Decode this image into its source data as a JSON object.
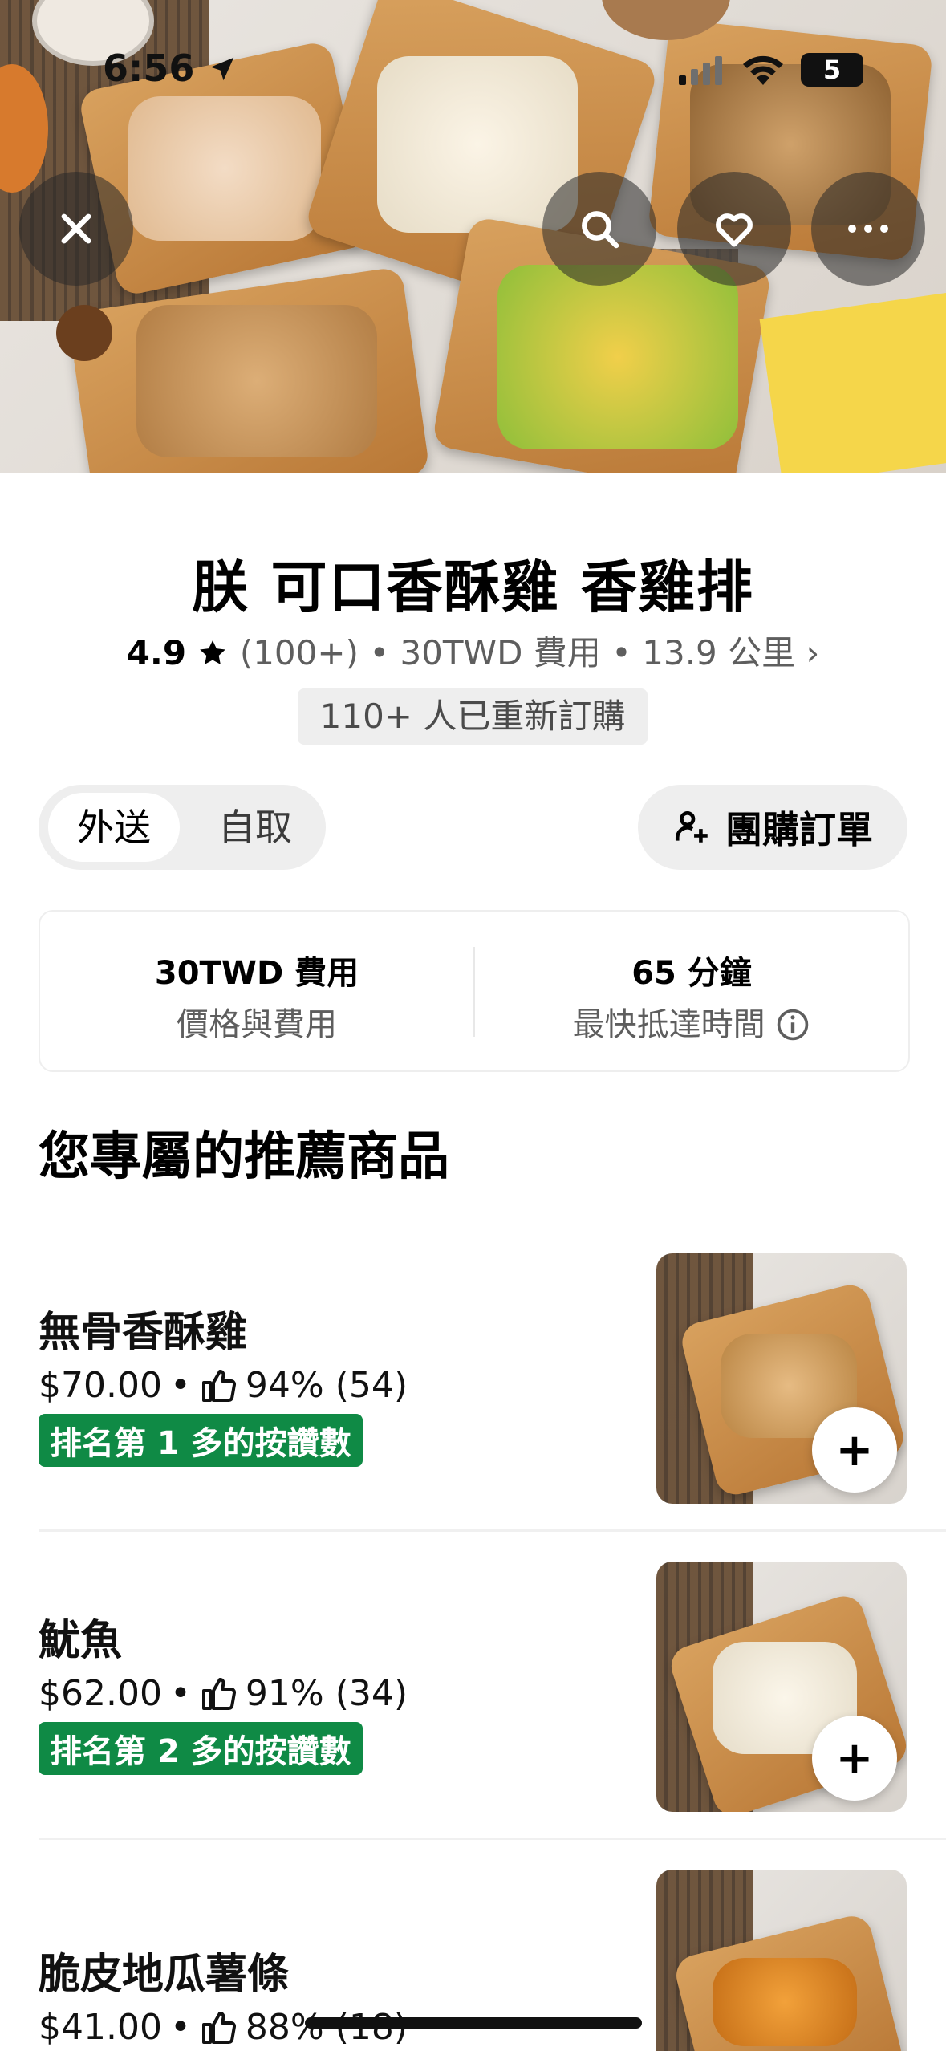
{
  "status_bar": {
    "time": "6:56",
    "battery": "5"
  },
  "restaurant": {
    "name": "朕 可口香酥雞 香雞排",
    "rating": "4.9",
    "rating_count": "(100+)",
    "fee": "30TWD 費用",
    "distance": "13.9 公里",
    "reorder": "110+ 人已重新訂購"
  },
  "mode_toggle": {
    "delivery": "外送",
    "pickup": "自取"
  },
  "group_order": {
    "label": "團購訂單"
  },
  "info": {
    "fee_main": "30TWD 費用",
    "fee_sub": "價格與費用",
    "time_main": "65 分鐘",
    "time_sub": "最快抵達時間"
  },
  "section_title": "您專屬的推薦商品",
  "items": [
    {
      "name": "無骨香酥雞",
      "price": "$70.00",
      "like": "94% (54)",
      "badge": "排名第 1 多的按讚數"
    },
    {
      "name": "魷魚",
      "price": "$62.00",
      "like": "91% (34)",
      "badge": "排名第 2 多的按讚數"
    },
    {
      "name": "脆皮地瓜薯條",
      "price": "$41.00",
      "like": "88% (18)",
      "badge": ""
    }
  ],
  "icons": {
    "close": "close-icon",
    "search": "search-icon",
    "favorite": "heart-icon",
    "more": "more-icon",
    "group": "add-person-icon",
    "info": "info-icon",
    "like": "thumbs-up-icon",
    "add": "plus-icon",
    "location": "location-arrow-icon"
  },
  "colors": {
    "badge": "#0f8a45",
    "chip_bg": "#eeeeee",
    "muted_text": "#5e5e5e"
  }
}
